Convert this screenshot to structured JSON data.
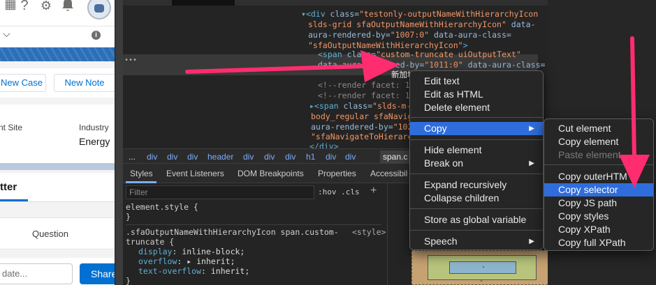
{
  "colors": {
    "arrow": "#ff2d6f",
    "accent_blue": "#0070d2",
    "menu_highlight": "#2f6ddc"
  },
  "salesforce": {
    "top_icons": [
      "help-icon",
      "gear-icon",
      "bell-icon"
    ],
    "actions": {
      "new_case": "New Case",
      "new_note": "New Note"
    },
    "fields": {
      "site_label": "nt Site",
      "industry_label": "Industry",
      "industry_value": "Energy"
    },
    "tabs": {
      "chatter": "tter"
    },
    "publisher": {
      "question": "Question"
    },
    "post": {
      "placeholder": "date...",
      "share": "Share"
    }
  },
  "devtools": {
    "dom": {
      "line1_tag": "▾<div ",
      "line1_attr": "class=",
      "line1_val": "\"testonly-outputNameWithHierarchyIcon",
      "line2": "slds-grid sfaOutputNameWithHierarchyIcon\"",
      "line2_attr": " data-",
      "line3_attr": "aura-rendered-by=",
      "line3_val": "\"1007:0\"",
      "line3_attr2": " data-aura-class=",
      "line4_val": "\"sfaOutputNameWithHierarchyIcon\"",
      "line4_tag": ">",
      "sel1_tag": "<span ",
      "sel1_attr": "class=",
      "sel1_val": "\"custom-truncate uiOutputText\"",
      "sel2_attr": "data-aura-rendered-by=",
      "sel2_val": "\"1011:0\"",
      "sel2_attr2": " data-aura-class=",
      "sel3_text": "新加坡",
      "c1": "<!--render facet: 10",
      "c2": "<!--render facet: 10",
      "span2_tag": "▸<span ",
      "span2_attr": "class=",
      "span2_val": "\"slds-m-",
      "l8_val": "body_regular sfaNavigat",
      "l9_attr": "aura-rendered-by=",
      "l9_val": "\"102",
      "l10_val": "\"sfaNavigateToHierarch",
      "close_div": "</div>"
    },
    "breadcrumbs": [
      "...",
      "div",
      "div",
      "div",
      "header",
      "div",
      "div",
      "div",
      "h1",
      "div",
      "div",
      "span.c"
    ],
    "tabs": [
      "Styles",
      "Event Listeners",
      "DOM Breakpoints",
      "Properties",
      "Accessibil"
    ],
    "filter_placeholder": "Filter",
    "hov_cls": ":hov  .cls",
    "styles": {
      "element_style": "element.style {",
      "element_close": "}",
      "rule_selector": ".sfaOutputNameWithHierarchyIcon span.custom-",
      "rule_selector2": "truncate {",
      "rule_source": "<style>",
      "props": [
        {
          "name": "display",
          "value": "inline-block;"
        },
        {
          "name": "overflow",
          "value": "▸ inherit;"
        },
        {
          "name": "text-overflow",
          "value": "inherit;"
        }
      ],
      "rule_close": "}"
    },
    "box_dash": "-"
  },
  "context_menu": {
    "items": {
      "edit_text": "Edit text",
      "edit_html": "Edit as HTML",
      "delete_element": "Delete element",
      "copy": "Copy",
      "hide_element": "Hide element",
      "break_on": "Break on",
      "expand_recursively": "Expand recursively",
      "collapse_children": "Collapse children",
      "store_global": "Store as global variable",
      "speech": "Speech"
    },
    "submenu_arrow": "▶"
  },
  "copy_submenu": {
    "items": {
      "cut_element": "Cut element",
      "copy_element": "Copy element",
      "paste_element": "Paste element",
      "copy_outerhtml": "Copy outerHTM",
      "copy_selector": "Copy selector",
      "copy_js_path": "Copy JS path",
      "copy_styles": "Copy styles",
      "copy_xpath": "Copy XPath",
      "copy_full_xpath": "Copy full XPath"
    }
  }
}
